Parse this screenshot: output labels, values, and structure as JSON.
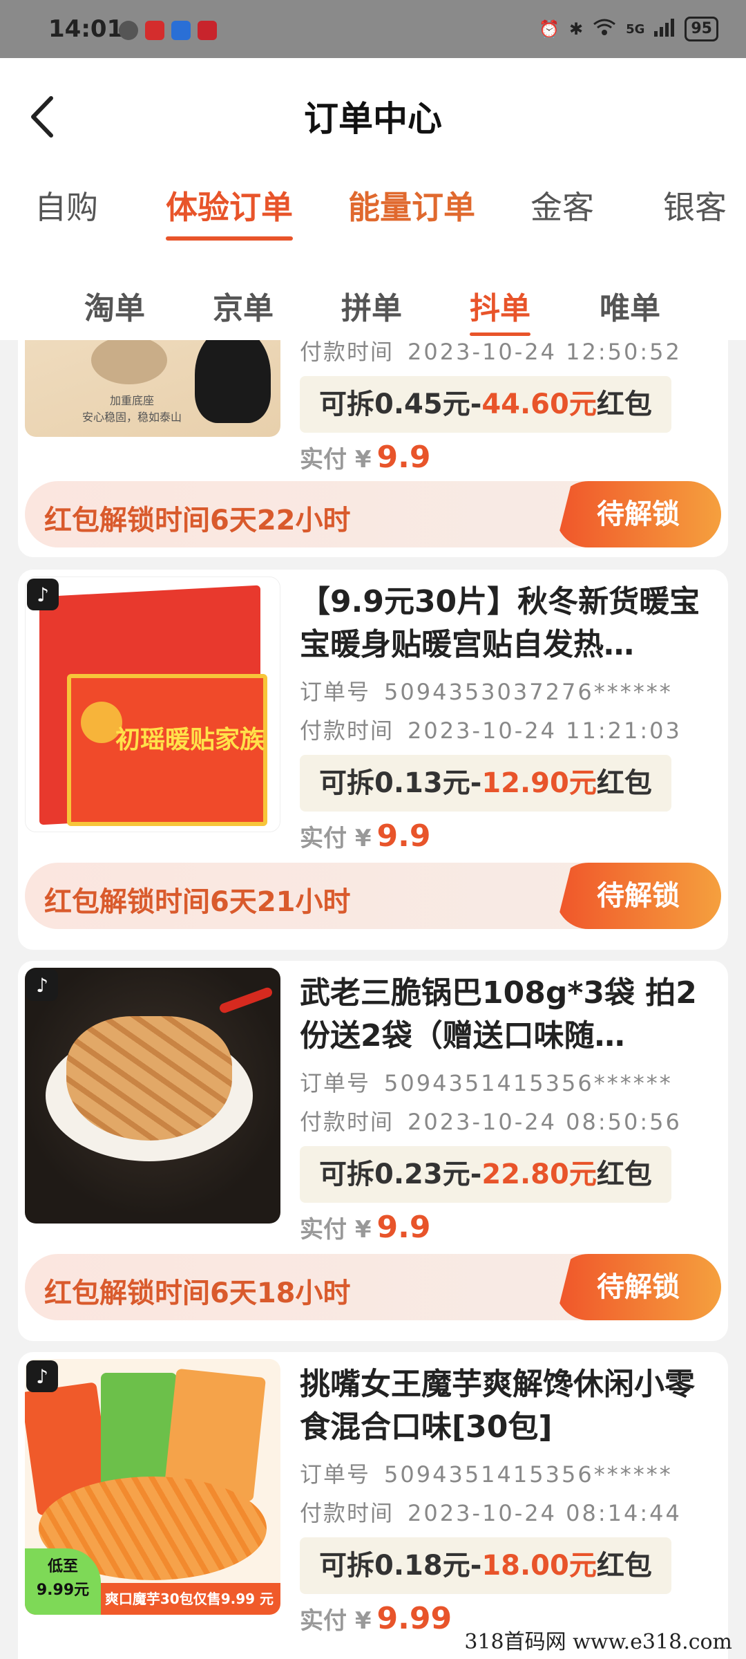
{
  "status": {
    "time": "14:01",
    "network": "5G",
    "battery": "95"
  },
  "header": {
    "title": "订单中心"
  },
  "top_tabs": [
    {
      "label": "自购"
    },
    {
      "label": "体验订单"
    },
    {
      "label": "能量订单"
    },
    {
      "label": "金客"
    },
    {
      "label": "银客"
    }
  ],
  "sub_tabs": [
    {
      "label": "淘单"
    },
    {
      "label": "京单"
    },
    {
      "label": "拼单"
    },
    {
      "label": "抖单"
    },
    {
      "label": "唯单"
    }
  ],
  "labels": {
    "order_no": "订单号",
    "pay_time": "付款时间",
    "can_split": "可拆",
    "red_packet": "红包",
    "paid": "实付",
    "currency": "¥",
    "unlock_button": "待解锁"
  },
  "orders": [
    {
      "title": "",
      "order_no": "",
      "pay_time": "2023-10-24 12:50:52",
      "split_amount": "0.45元",
      "red_amount": "44.60元",
      "paid": "9.9",
      "unlock_text": "红包解锁时间6天22小时",
      "thumb_caption": "加重底座\n安心稳固，稳如泰山"
    },
    {
      "title": "【9.9元30片】秋冬新货暖宝宝暖身贴暖宫贴自发热…",
      "order_no": "5094353037276******",
      "pay_time": "2023-10-24 11:21:03",
      "split_amount": "0.13元",
      "red_amount": "12.90元",
      "paid": "9.9",
      "unlock_text": "红包解锁时间6天21小时",
      "thumb_caption": "初瑶暖贴家族"
    },
    {
      "title": "武老三脆锅巴108g*3袋 拍2份送2袋（赠送口味随…",
      "order_no": "5094351415356******",
      "pay_time": "2023-10-24 08:50:56",
      "split_amount": "0.23元",
      "red_amount": "22.80元",
      "paid": "9.9",
      "unlock_text": "红包解锁时间6天18小时"
    },
    {
      "title": "挑嘴女王魔芋爽解馋休闲小零食混合口味[30包]",
      "order_no": "5094351415356******",
      "pay_time": "2023-10-24 08:14:44",
      "split_amount": "0.18元",
      "red_amount": "18.00元",
      "paid": "9.99",
      "thumb_caption": "爽口魔芋30包仅售9.99 元",
      "thumb_badge": "低至\n9.99元"
    }
  ],
  "watermark": "318首码网  www.e318.com",
  "colors": {
    "accent": "#e8542a",
    "status_bar": "#8a8a8a"
  }
}
